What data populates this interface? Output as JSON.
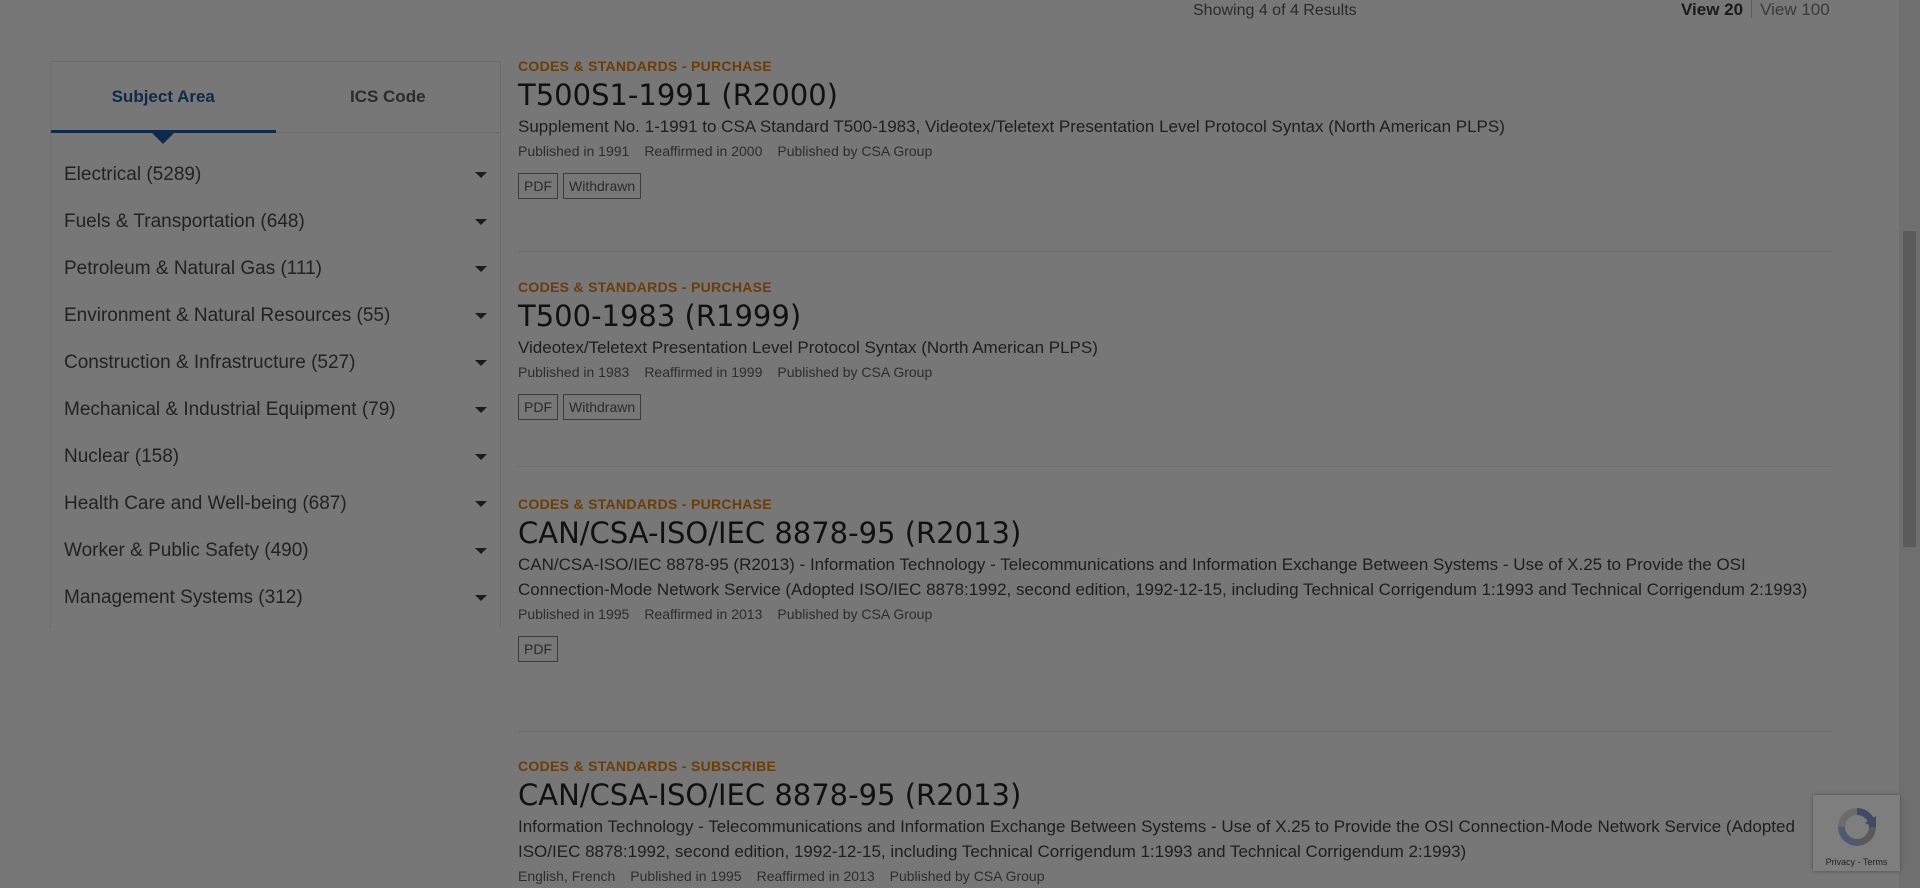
{
  "header": {
    "results_count": "Showing 4 of 4 Results",
    "view_20": "View 20",
    "view_100": "View 100"
  },
  "sidebar": {
    "tabs": [
      {
        "label": "Subject Area",
        "active": true
      },
      {
        "label": "ICS Code",
        "active": false
      }
    ],
    "facets": [
      {
        "label": "Electrical (5289)"
      },
      {
        "label": "Fuels & Transportation (648)"
      },
      {
        "label": "Petroleum & Natural Gas (111)"
      },
      {
        "label": "Environment & Natural Resources (55)"
      },
      {
        "label": "Construction & Infrastructure (527)"
      },
      {
        "label": "Mechanical & Industrial Equipment (79)"
      },
      {
        "label": "Nuclear (158)"
      },
      {
        "label": "Health Care and Well-being (687)"
      },
      {
        "label": "Worker & Public Safety (490)"
      },
      {
        "label": "Management Systems (312)"
      }
    ]
  },
  "results": [
    {
      "category": "CODES & STANDARDS - PURCHASE",
      "title": "T500S1-1991 (R2000)",
      "description": "Supplement No. 1-1991 to CSA Standard T500-1983, Videotex/Teletext Presentation Level Protocol Syntax (North American PLPS)",
      "published": "Published in 1991",
      "reaffirmed": "Reaffirmed in 2000",
      "publisher": "Published by CSA Group",
      "tags": [
        "PDF",
        "Withdrawn"
      ]
    },
    {
      "category": "CODES & STANDARDS - PURCHASE",
      "title": "T500-1983 (R1999)",
      "description": "Videotex/Teletext Presentation Level Protocol Syntax (North American PLPS)",
      "published": "Published in 1983",
      "reaffirmed": "Reaffirmed in 1999",
      "publisher": "Published by CSA Group",
      "tags": [
        "PDF",
        "Withdrawn"
      ]
    },
    {
      "category": "CODES & STANDARDS - PURCHASE",
      "title": "CAN/CSA-ISO/IEC 8878-95 (R2013)",
      "description": "CAN/CSA-ISO/IEC 8878-95 (R2013) - Information Technology - Telecommunications and Information Exchange Between Systems - Use of X.25 to Provide the OSI Connection-Mode Network Service (Adopted ISO/IEC 8878:1992, second edition, 1992-12-15, including Technical Corrigendum 1:1993 and Technical Corrigendum 2:1993)",
      "published": "Published in 1995",
      "reaffirmed": "Reaffirmed in 2013",
      "publisher": "Published by CSA Group",
      "tags": [
        "PDF"
      ]
    },
    {
      "category": "CODES & STANDARDS - SUBSCRIBE",
      "title": "CAN/CSA-ISO/IEC 8878-95 (R2013)",
      "description": "Information Technology - Telecommunications and Information Exchange Between Systems - Use of X.25 to Provide the OSI Connection-Mode Network Service (Adopted ISO/IEC 8878:1992, second edition, 1992-12-15, including Technical Corrigendum 1:1993 and Technical Corrigendum 2:1993)",
      "languages": "English, French",
      "published": "Published in 1995",
      "reaffirmed": "Reaffirmed in 2013",
      "publisher": "Published by CSA Group",
      "tags": []
    }
  ],
  "recaptcha": {
    "footer": "Privacy - Terms"
  }
}
